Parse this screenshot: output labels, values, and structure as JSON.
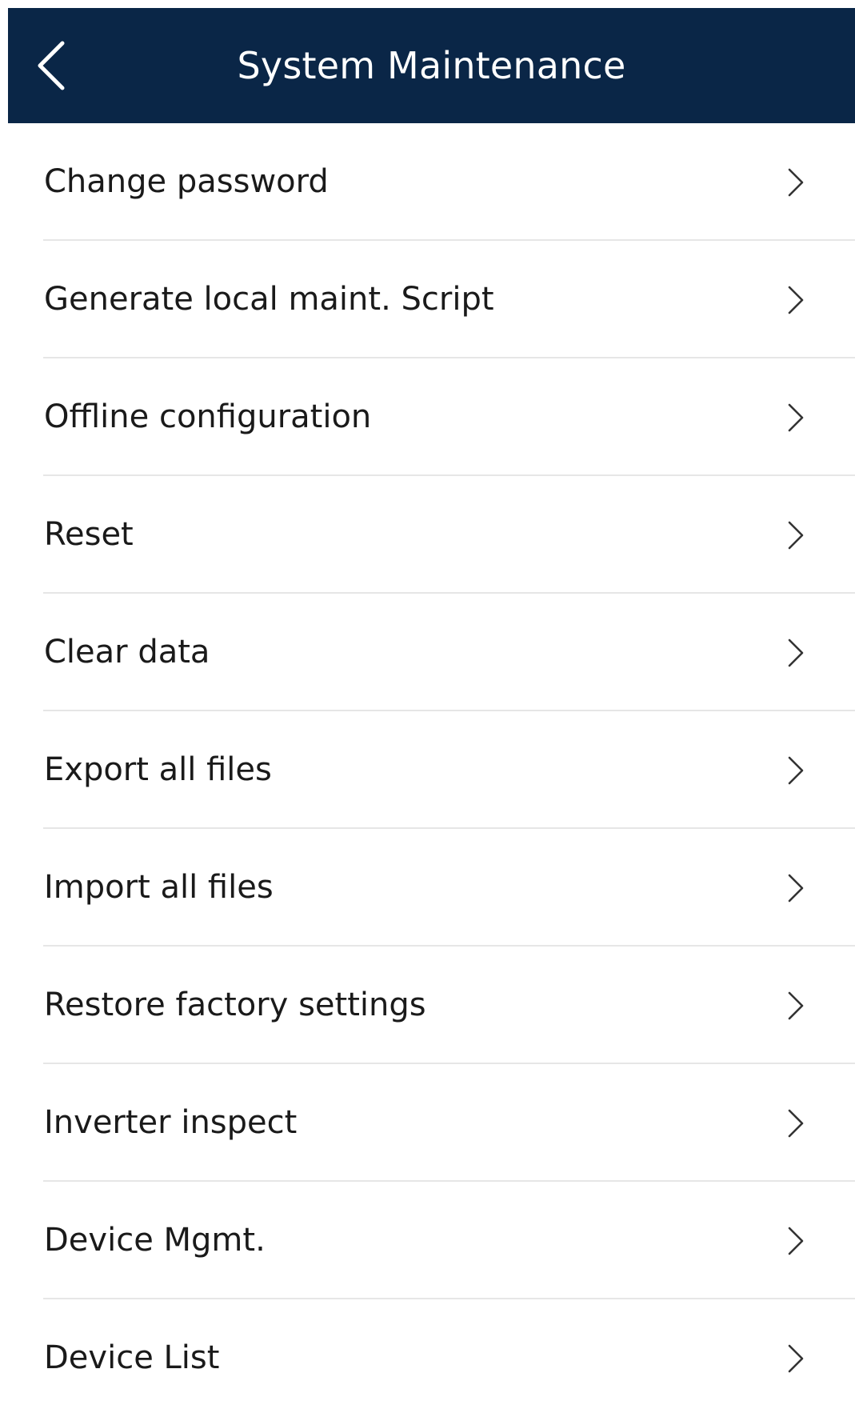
{
  "header": {
    "title": "System Maintenance",
    "back_icon": "chevron-left-icon"
  },
  "colors": {
    "header_background": "#0a2647",
    "header_text": "#ffffff",
    "item_text": "#1a1a1a",
    "divider": "#e6e6e6",
    "chevron": "#333333"
  },
  "menu": {
    "items": [
      {
        "label": "Change password",
        "icon": "chevron-right-icon"
      },
      {
        "label": "Generate local maint. Script",
        "icon": "chevron-right-icon"
      },
      {
        "label": "Offline configuration",
        "icon": "chevron-right-icon"
      },
      {
        "label": "Reset",
        "icon": "chevron-right-icon"
      },
      {
        "label": "Clear data",
        "icon": "chevron-right-icon"
      },
      {
        "label": "Export all files",
        "icon": "chevron-right-icon"
      },
      {
        "label": "Import all files",
        "icon": "chevron-right-icon"
      },
      {
        "label": "Restore factory settings",
        "icon": "chevron-right-icon"
      },
      {
        "label": "Inverter inspect",
        "icon": "chevron-right-icon"
      },
      {
        "label": "Device Mgmt.",
        "icon": "chevron-right-icon"
      },
      {
        "label": "Device List",
        "icon": "chevron-right-icon"
      }
    ]
  }
}
